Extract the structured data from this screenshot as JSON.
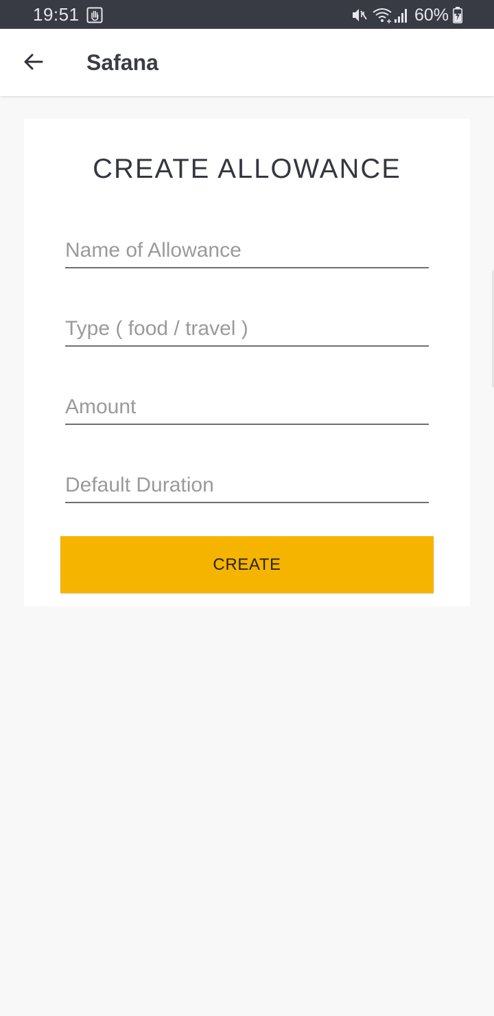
{
  "status_bar": {
    "time": "19:51",
    "battery": "60%",
    "icons": [
      "hand-gesture-icon",
      "mute-icon",
      "wifi-icon",
      "signal-icon",
      "battery-charging-icon"
    ]
  },
  "app_bar": {
    "title": "Safana",
    "back_icon": "arrow-left-icon"
  },
  "form": {
    "title": "CREATE ALLOWANCE",
    "fields": [
      {
        "placeholder": "Name of Allowance",
        "value": ""
      },
      {
        "placeholder": "Type ( food / travel )",
        "value": ""
      },
      {
        "placeholder": "Amount",
        "value": ""
      },
      {
        "placeholder": "Default Duration",
        "value": ""
      }
    ],
    "submit_label": "CREATE"
  },
  "colors": {
    "status_bar_bg": "#383b44",
    "accent": "#f5b400",
    "page_bg": "#f8f8f8"
  }
}
